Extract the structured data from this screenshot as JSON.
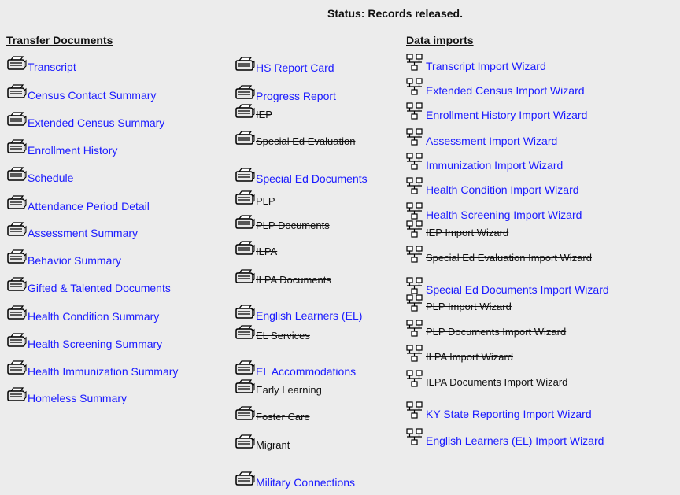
{
  "status": {
    "text": "Status: Records released."
  },
  "transfer": {
    "heading": "Transfer Documents",
    "col1": [
      {
        "label": "Transcript",
        "enabled": true
      },
      {
        "label": "Census Contact Summary",
        "enabled": true
      },
      {
        "label": "Extended Census Summary",
        "enabled": true
      },
      {
        "label": "Enrollment History",
        "enabled": true
      },
      {
        "label": "Schedule",
        "enabled": true
      },
      {
        "label": "Attendance Period Detail",
        "enabled": true
      },
      {
        "label": "Assessment Summary",
        "enabled": true
      },
      {
        "label": "Behavior Summary",
        "enabled": true
      },
      {
        "label": "Gifted & Talented Documents",
        "enabled": true
      },
      {
        "label": "Health Condition Summary",
        "enabled": true
      },
      {
        "label": "Health Screening Summary",
        "enabled": true
      },
      {
        "label": "Health Immunization Summary",
        "enabled": true
      },
      {
        "label": "Homeless Summary",
        "enabled": true
      }
    ],
    "col2": [
      {
        "label": "HS Report Card",
        "enabled": true
      },
      {
        "label": "Progress Report",
        "enabled": true
      },
      {
        "label": "IEP",
        "enabled": false
      },
      {
        "label": "Special Ed Evaluation",
        "enabled": false
      },
      {
        "label": "Special Ed Documents",
        "enabled": true
      },
      {
        "label": "PLP",
        "enabled": false
      },
      {
        "label": "PLP Documents",
        "enabled": false
      },
      {
        "label": "ILPA",
        "enabled": false
      },
      {
        "label": "ILPA Documents",
        "enabled": false
      },
      {
        "label": "English Learners (EL)",
        "enabled": true
      },
      {
        "label": "EL Services",
        "enabled": false
      },
      {
        "label": "EL Accommodations",
        "enabled": true
      },
      {
        "label": "Early Learning",
        "enabled": false
      },
      {
        "label": "Foster Care",
        "enabled": false
      },
      {
        "label": "Migrant",
        "enabled": false
      },
      {
        "label": "Military Connections",
        "enabled": true
      }
    ]
  },
  "imports": {
    "heading": "Data imports",
    "items": [
      {
        "label": "Transcript Import Wizard",
        "enabled": true
      },
      {
        "label": "Extended Census Import Wizard",
        "enabled": true
      },
      {
        "label": "Enrollment History Import Wizard",
        "enabled": true
      },
      {
        "label": "Assessment Import Wizard",
        "enabled": true
      },
      {
        "label": "Immunization Import Wizard",
        "enabled": true
      },
      {
        "label": "Health Condition Import Wizard",
        "enabled": true
      },
      {
        "label": "Health Screening Import Wizard",
        "enabled": true
      },
      {
        "label": "IEP Import Wizard",
        "enabled": false
      },
      {
        "label": "Special Ed Evaluation Import Wizard",
        "enabled": false
      },
      {
        "label": "Special Ed Documents Import Wizard",
        "enabled": true
      },
      {
        "label": "PLP Import Wizard",
        "enabled": false
      },
      {
        "label": "PLP Documents Import Wizard",
        "enabled": false
      },
      {
        "label": "ILPA Import Wizard",
        "enabled": false
      },
      {
        "label": "ILPA Documents Import Wizard",
        "enabled": false
      },
      {
        "label": "KY State Reporting Import Wizard",
        "enabled": true
      },
      {
        "label": "English Learners (EL) Import Wizard",
        "enabled": true
      }
    ]
  },
  "icons": {
    "document": "printer-icon",
    "import": "network-icon"
  },
  "colors": {
    "link": "#1a1aff",
    "disabled": "#111111",
    "background": "#ececec"
  }
}
